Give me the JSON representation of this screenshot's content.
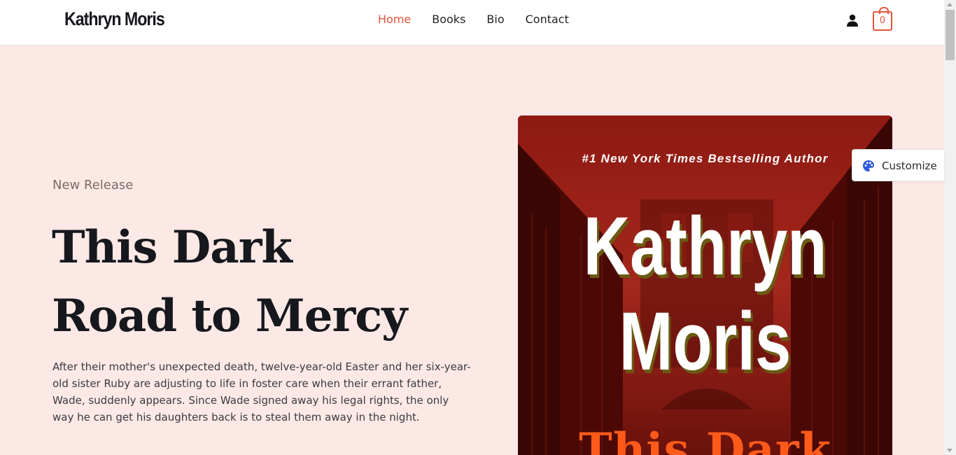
{
  "header": {
    "logo": "Kathryn Moris",
    "nav": [
      {
        "label": "Home",
        "active": true
      },
      {
        "label": "Books",
        "active": false
      },
      {
        "label": "Bio",
        "active": false
      },
      {
        "label": "Contact",
        "active": false
      }
    ],
    "user_icon": "user-icon",
    "cart_count": "0",
    "accent_color": "#e2553a"
  },
  "hero": {
    "eyebrow": "New Release",
    "title_line1": "This Dark",
    "title_line2": "Road to Mercy",
    "description": "After their mother's unexpected death, twelve-year-old Easter and her six-year-old sister Ruby are adjusting to life in foster care when their errant father, Wade, suddenly appears. Since Wade signed away his legal rights, the only way he can get his daughters back is to steal them away in the night."
  },
  "cover": {
    "tagline": "#1 New York Times Bestselling Author",
    "author_first": "Kathryn",
    "author_last": "Moris",
    "book_title_partial": "This Dark"
  },
  "customize": {
    "label": "Customize",
    "icon": "palette-icon"
  },
  "colors": {
    "background": "#fce9e6",
    "text_dark": "#16181d",
    "cover_red": "#7a1410"
  }
}
